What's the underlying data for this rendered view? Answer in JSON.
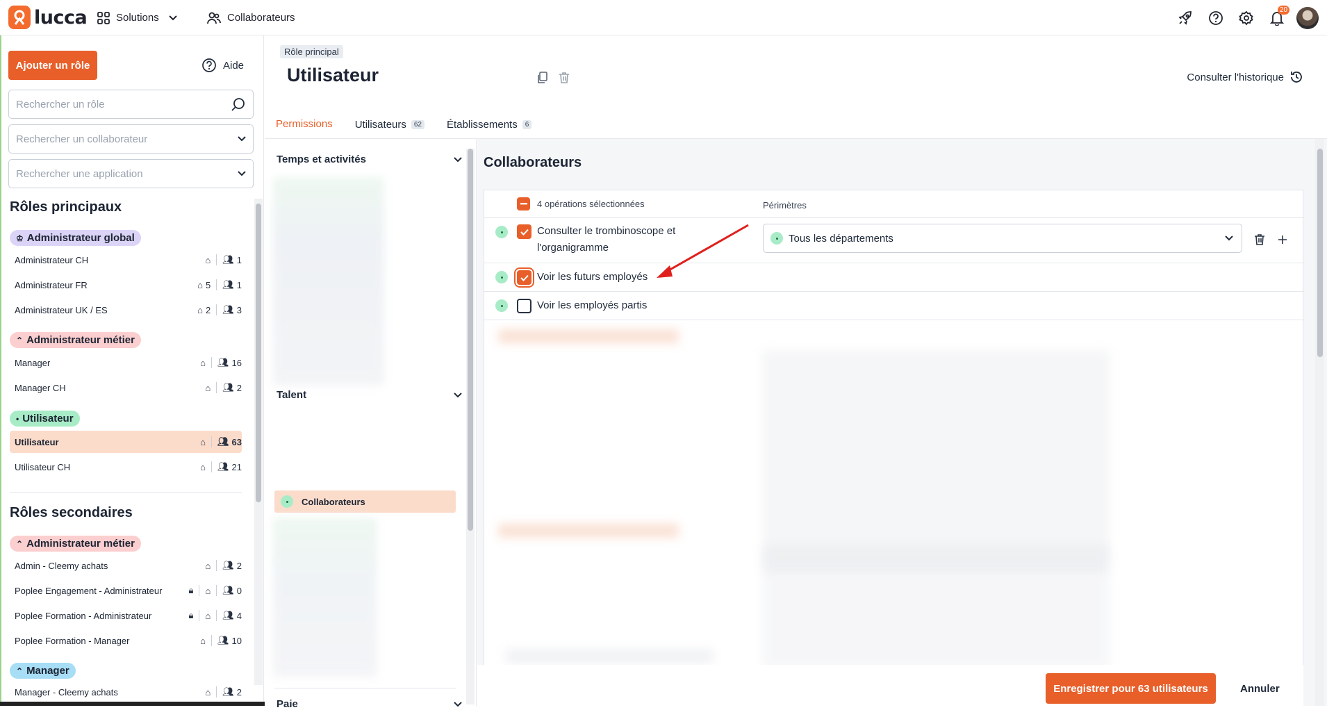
{
  "topbar": {
    "logo_text": "lucca",
    "nav": [
      {
        "label": "Solutions",
        "icon": "grid-icon"
      },
      {
        "label": "Collaborateurs",
        "icon": "users-icon"
      }
    ],
    "notification_count": "20"
  },
  "sidebar": {
    "add_role_label": "Ajouter un rôle",
    "help_label": "Aide",
    "search_role_placeholder": "Rechercher un rôle",
    "search_employee_placeholder": "Rechercher un collaborateur",
    "search_app_placeholder": "Rechercher une application",
    "primary_title": "Rôles principaux",
    "secondary_title": "Rôles secondaires",
    "groups": [
      {
        "label": "Administrateur global",
        "roles": [
          {
            "name": "Administrateur CH",
            "sites": "",
            "count": "1"
          },
          {
            "name": "Administrateur FR",
            "sites": "5",
            "count": "1"
          },
          {
            "name": "Administrateur UK / ES",
            "sites": "2",
            "count": "3"
          }
        ]
      },
      {
        "label": "Administrateur métier",
        "roles": [
          {
            "name": "Manager",
            "sites": "",
            "count": "16"
          },
          {
            "name": "Manager CH",
            "sites": "",
            "count": "2"
          }
        ]
      },
      {
        "label": "Utilisateur",
        "roles": [
          {
            "name": "Utilisateur",
            "sites": "",
            "count": "63"
          },
          {
            "name": "Utilisateur CH",
            "sites": "",
            "count": "21"
          }
        ]
      }
    ],
    "secondary_groups": [
      {
        "label": "Administrateur métier",
        "roles": [
          {
            "name": "Admin - Cleemy achats",
            "count": "2"
          },
          {
            "name": "Poplee Engagement - Administrateur",
            "count": "0"
          },
          {
            "name": "Poplee Formation - Administrateur",
            "count": "4"
          },
          {
            "name": "Poplee Formation - Manager",
            "count": "10"
          }
        ]
      },
      {
        "label": "Manager",
        "roles": [
          {
            "name": "Manager - Cleemy achats",
            "count": "2"
          }
        ]
      }
    ]
  },
  "header": {
    "tag": "Rôle principal",
    "title": "Utilisateur",
    "history_label": "Consulter l'historique",
    "tabs": [
      {
        "label": "Permissions",
        "count": ""
      },
      {
        "label": "Utilisateurs",
        "count": "62"
      },
      {
        "label": "Établissements",
        "count": "6"
      }
    ]
  },
  "categories": {
    "time": "Temps et activités",
    "talent": "Talent",
    "active_item": "Collaborateurs",
    "pay": "Paie"
  },
  "permissions": {
    "title": "Collaborateurs",
    "selected_ops": "4 opérations sélectionnées",
    "scopes_header": "Périmètres",
    "op1_line1": "Consulter le trombinoscope et",
    "op1_line2": "l'organigramme",
    "op1_scope": "Tous les départements",
    "op2": "Voir les futurs employés",
    "op3": "Voir les employés partis"
  },
  "footer": {
    "save_label": "Enregistrer pour 63 utilisateurs",
    "cancel_label": "Annuler"
  },
  "colors": {
    "accent": "#e85f2a",
    "brand": "#f46b2e",
    "green_dot": "#a8ecc7"
  }
}
